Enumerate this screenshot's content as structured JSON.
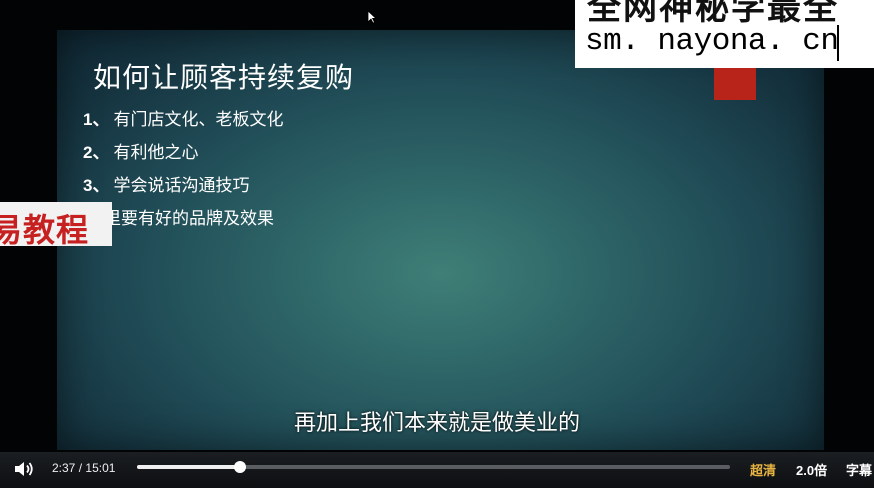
{
  "slide": {
    "title": "如何让顾客持续复购",
    "items": [
      {
        "num": "1、",
        "text": "有门店文化、老板文化"
      },
      {
        "num": "2、",
        "text": "有利他之心"
      },
      {
        "num": "3、",
        "text": "学会说话沟通技巧"
      },
      {
        "num": "",
        "text": "店里要有好的品牌及效果"
      }
    ]
  },
  "watermark": {
    "top_text": "全网神秘学最全",
    "url": "sm. nayona. cn",
    "left_text": "易教程"
  },
  "subtitle": "再加上我们本来就是做美业的",
  "controls": {
    "current_time": "2:37",
    "separator": "/",
    "duration": "15:01",
    "progress_fraction": 0.174,
    "quality_label": "超清",
    "speed_label": "2.0倍",
    "caption_label": "字幕",
    "quality_color": "#e8b341"
  },
  "icons": {
    "volume": "volume-icon",
    "cursor": "mouse-cursor-icon"
  }
}
